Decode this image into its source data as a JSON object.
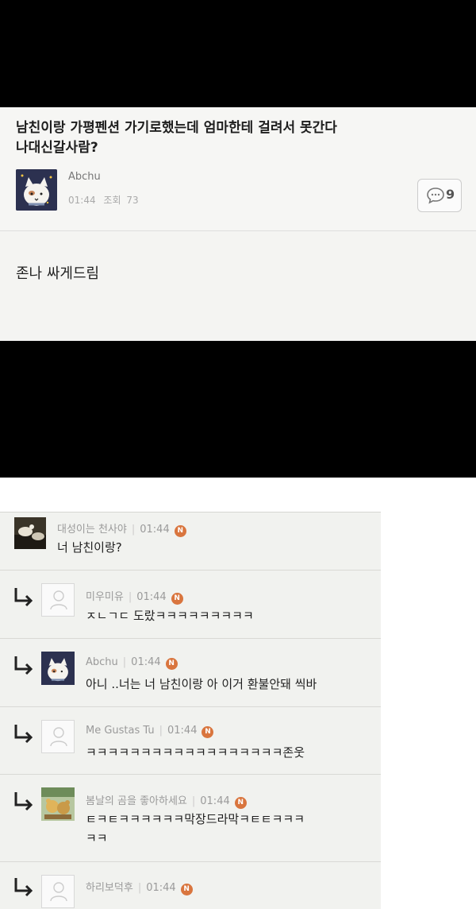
{
  "post": {
    "title_line1": "남친이랑 가평펜션 가기로했는데 엄마한테 걸려서 못간다",
    "title_line2": "나대신갈사람?",
    "author": "Abchu",
    "time": "01:44",
    "views_label": "조회",
    "views": "73",
    "comment_count": "9",
    "body": "존나 싸게드림"
  },
  "comments": [
    {
      "author": "대성이는 천사야",
      "time": "01:44",
      "badge": "N",
      "text": "너 남친이랑?"
    },
    {
      "author": "미우미유",
      "time": "01:44",
      "badge": "N",
      "text": "ㅈㄴㄱㄷ 도랐ㅋㅋㅋㅋㅋㅋㅋㅋㅋ"
    },
    {
      "author": "Abchu",
      "time": "01:44",
      "badge": "N",
      "text": "아니 ..너는 너 남친이랑 아 이거 환불안돼 씩바"
    },
    {
      "author": "Me Gustas Tu",
      "time": "01:44",
      "badge": "N",
      "text": "ㅋㅋㅋㅋㅋㅋㅋㅋㅋㅋㅋㅋㅋㅋㅋㅋㅋㅋ존웃"
    },
    {
      "author": "봄날의 곰을 좋아하세요",
      "time": "01:44",
      "badge": "N",
      "text_line1": "ㅌㅋㅌㅋㅋㅋㅋㅋㅋ막장드라막ㅋㅌㅌㅋㅋㅋ",
      "text_line2": "ㅋㅋ"
    },
    {
      "author": "하리보덕후",
      "time": "01:44",
      "badge": "N"
    }
  ],
  "colors": {
    "badge": "#d9753e",
    "comment_bg": "#f1f2ef",
    "post_bg": "#f6f6f4"
  },
  "icons": {
    "reply": "reply-arrow-icon",
    "comment": "comment-bubble-icon",
    "default_avatar": "person-icon"
  }
}
